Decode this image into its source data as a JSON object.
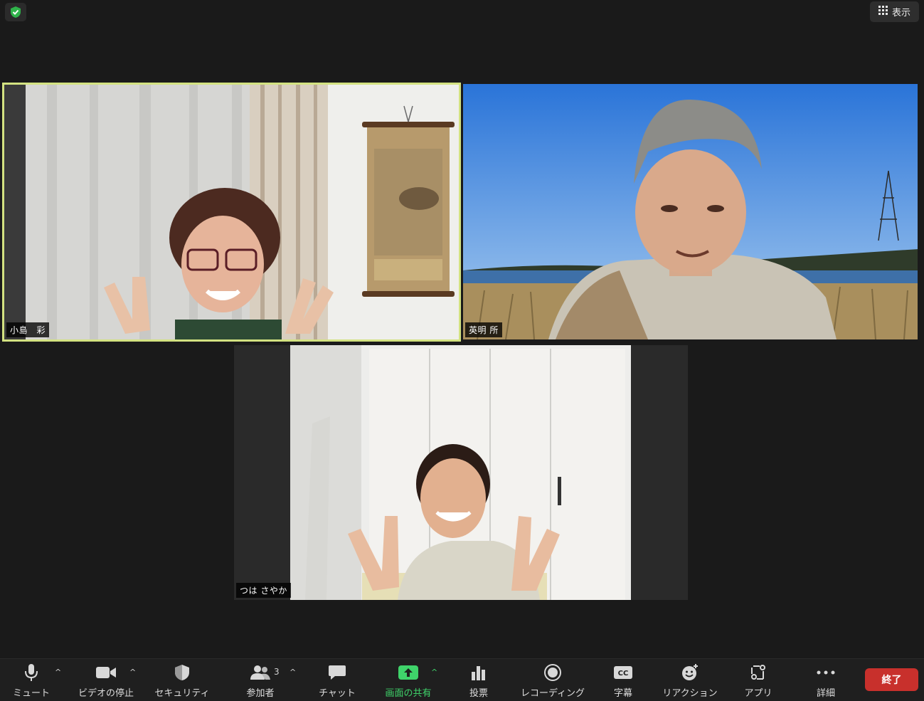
{
  "top": {
    "view_label": "表示",
    "shield_icon": "green-shield-check-icon"
  },
  "participants": [
    {
      "name": "小島　彩",
      "active_speaker": true,
      "highlight_color": "#d3e281"
    },
    {
      "name": "英明 所",
      "active_speaker": false
    },
    {
      "name": "つは さやか",
      "active_speaker": false
    }
  ],
  "toolbar": {
    "mute": "ミュート",
    "video": "ビデオの停止",
    "security": "セキュリティ",
    "participants": "参加者",
    "participants_count": "3",
    "chat": "チャット",
    "share": "画面の共有",
    "poll": "投票",
    "record": "レコーディング",
    "captions": "字幕",
    "captions_icon_text": "CC",
    "reactions": "リアクション",
    "apps": "アプリ",
    "more": "詳細",
    "end": "終了"
  },
  "colors": {
    "background": "#1a1a1a",
    "toolbar": "#1f1f1f",
    "share_green": "#3fd36a",
    "end_red": "#c8302c"
  }
}
